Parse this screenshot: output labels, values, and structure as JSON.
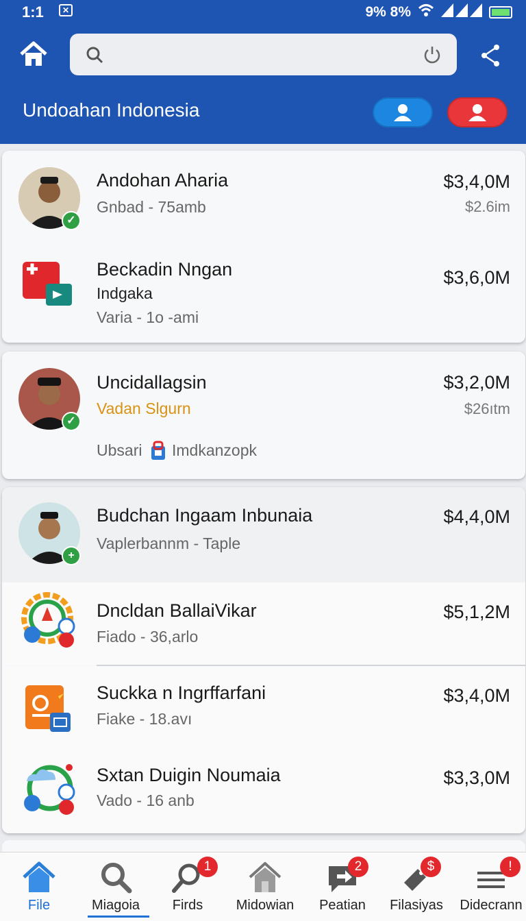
{
  "status": {
    "time": "1:1",
    "notif": "✕",
    "right": "9%  8%"
  },
  "header": {
    "title": "Undoahan Indonesia"
  },
  "search": {
    "placeholder": "",
    "value": ""
  },
  "items": [
    {
      "name": "Andohan Aharia",
      "sub": "Gnbad - 75amb",
      "amount": "$3,4,0M",
      "amount2": "$2.6im"
    },
    {
      "name": "Beckadin Nngan",
      "sub_line1": "Indgaka",
      "sub": "Varia - 1o -ami",
      "amount": "$3,6,0M"
    },
    {
      "name": "Uncidallagsin",
      "sub_orange": "Vadan Slgurn",
      "sub": "Ubsari",
      "sub_extra": "Imdkanzopk",
      "amount": "$3,2,0M",
      "amount2": "$26ıtm"
    },
    {
      "name": "Budchan Ingaam Inbunaia",
      "sub": "Vaplerbannm - Taple",
      "amount": "$4,4,0M"
    },
    {
      "name": "Dncldan BallaiVikar",
      "sub": "Fiado - 36,arlo",
      "amount": "$5,1,2M"
    },
    {
      "name": "Suckka n Ingrffarfani",
      "sub": "Fiake - 18.avı",
      "amount": "$3,4,0M"
    },
    {
      "name": "Sxtan Duigin Noumaia",
      "sub": "Vado - 16 anb",
      "amount": "$3,3,0M"
    }
  ],
  "nav": [
    {
      "label": "File",
      "icon": "house-icon",
      "active": true
    },
    {
      "label": "Miagoia",
      "icon": "search-icon"
    },
    {
      "label": "Firds",
      "icon": "magnifier-icon",
      "badge": "1"
    },
    {
      "label": "Midowian",
      "icon": "home-outline-icon"
    },
    {
      "label": "Peatian",
      "icon": "chat-icon",
      "badge": "2"
    },
    {
      "label": "Filasiyas",
      "icon": "tag-icon",
      "badge": "$"
    },
    {
      "label": "Didecrann",
      "icon": "menu-icon",
      "badge": "!"
    }
  ],
  "colors": {
    "header": "#1f55b2",
    "accent_blue": "#1d86e0",
    "accent_red": "#e8363a",
    "verified": "#2ea043"
  }
}
